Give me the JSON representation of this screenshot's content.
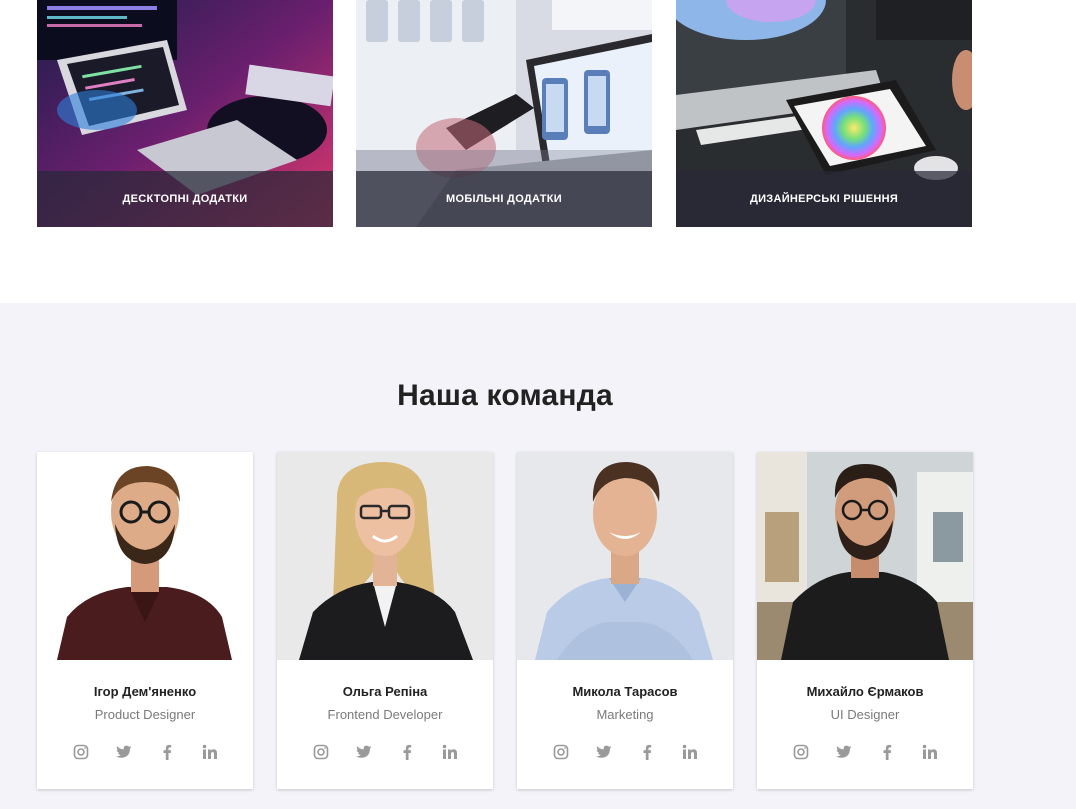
{
  "services": [
    {
      "label": "ДЕСКТОПНІ ДОДАТКИ",
      "photo": "desktop-developer-photo"
    },
    {
      "label": "МОБІЛЬНІ ДОДАТКИ",
      "photo": "mobile-apps-photo"
    },
    {
      "label": "ДИЗАЙНЕРСЬКІ РІШЕННЯ",
      "photo": "design-solutions-photo"
    }
  ],
  "team": {
    "title": "Наша команда",
    "members": [
      {
        "name": "Ігор Дем'яненко",
        "role": "Product Designer"
      },
      {
        "name": "Ольга Репіна",
        "role": "Frontend Developer"
      },
      {
        "name": "Микола Тарасов",
        "role": "Marketing"
      },
      {
        "name": "Михайло Єрмаков",
        "role": "UI Designer"
      }
    ],
    "social_icons": [
      "instagram-icon",
      "twitter-icon",
      "facebook-icon",
      "linkedin-icon"
    ]
  },
  "colors": {
    "section_bg": "#f3f3f9",
    "caption_bg": "#282837",
    "icon": "#9a9a9a",
    "name_text": "#222222",
    "role_text": "#7a7a7a"
  }
}
